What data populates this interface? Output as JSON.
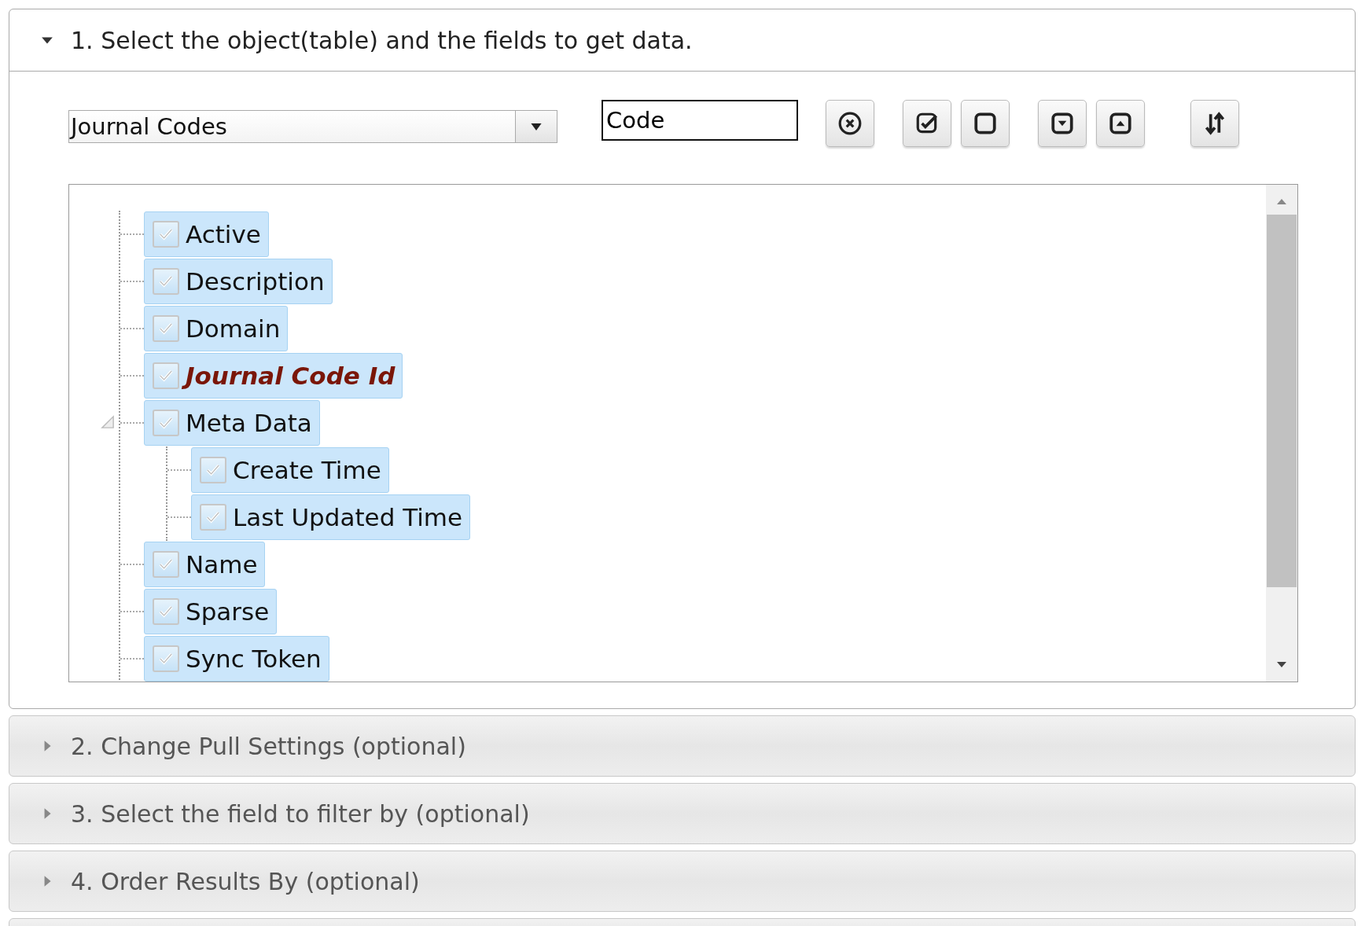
{
  "sections": [
    {
      "title": "1. Select the object(table) and the fields to get data.",
      "expanded": true
    },
    {
      "title": "2. Change Pull Settings (optional)",
      "expanded": false
    },
    {
      "title": "3. Select the field to filter by (optional)",
      "expanded": false
    },
    {
      "title": "4. Order Results By (optional)",
      "expanded": false
    }
  ],
  "object_select": {
    "value": "Journal Codes"
  },
  "search": {
    "value": "Code"
  },
  "fields": [
    {
      "label": "Active",
      "checked": true,
      "key": false
    },
    {
      "label": "Description",
      "checked": true,
      "key": false
    },
    {
      "label": "Domain",
      "checked": true,
      "key": false
    },
    {
      "label": "Journal Code Id",
      "checked": true,
      "key": true
    },
    {
      "label": "Meta Data",
      "checked": true,
      "key": false,
      "expanded": true,
      "children": [
        {
          "label": "Create Time",
          "checked": true,
          "key": false
        },
        {
          "label": "Last Updated Time",
          "checked": true,
          "key": false
        }
      ]
    },
    {
      "label": "Name",
      "checked": true,
      "key": false
    },
    {
      "label": "Sparse",
      "checked": true,
      "key": false
    },
    {
      "label": "Sync Token",
      "checked": true,
      "key": false
    }
  ]
}
